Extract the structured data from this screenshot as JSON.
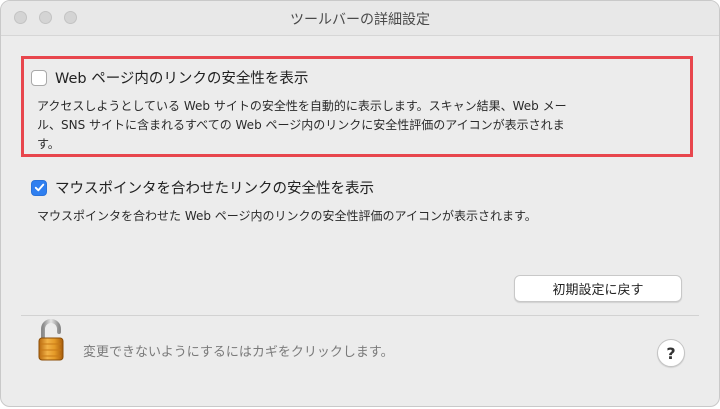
{
  "window": {
    "title": "ツールバーの詳細設定"
  },
  "option1": {
    "label": "Web ページ内のリンクの安全性を表示",
    "checked": false,
    "description_line1": "アクセスしようとしている Web サイトの安全性を自動的に表示します。スキャン結果、Web メー",
    "description_line2": "ル、SNS サイトに含まれるすべての Web ページ内のリンクに安全性評価のアイコンが表示されま",
    "description_line3": "す。",
    "highlight_color": "#e8464d"
  },
  "option2": {
    "label": "マウスポインタを合わせたリンクの安全性を表示",
    "checked": true,
    "description": "マウスポインタを合わせた Web ページ内のリンクの安全性評価のアイコンが表示されます。"
  },
  "buttons": {
    "reset_label": "初期設定に戻す",
    "help_label": "?"
  },
  "footer": {
    "lock_text": "変更できないようにするにはカギをクリックします。",
    "lock_icon": "padlock-open-icon"
  },
  "colors": {
    "accent": "#2f7ff0"
  }
}
